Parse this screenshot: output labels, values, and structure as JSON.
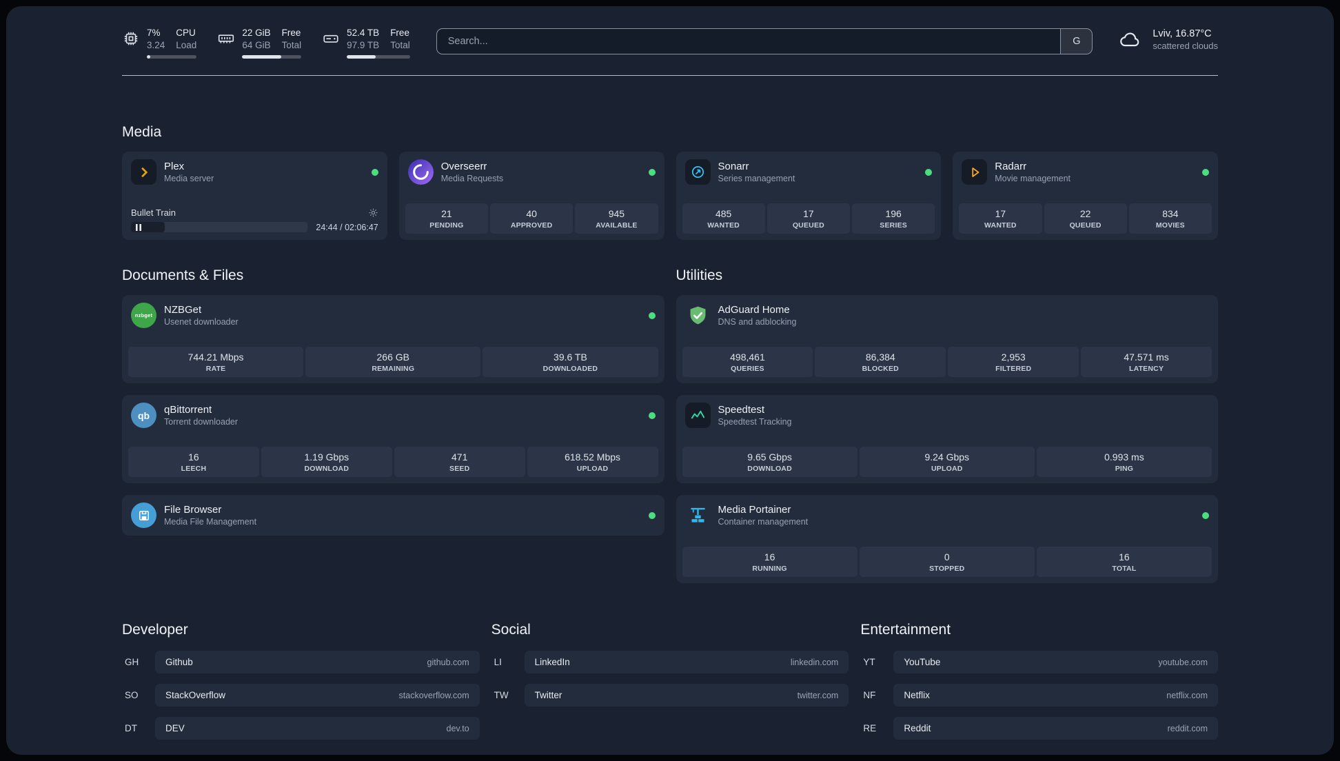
{
  "colors": {
    "status-green": "#4ade80",
    "plex-accent": "#e5a00d",
    "sonarr-accent": "#35c5f4",
    "radarr-accent": "#f9a825",
    "nzbget-accent": "#3fa549",
    "qbittorrent-accent": "#4d8fc0",
    "filebrowser-accent": "#459fd6",
    "adguard-accent": "#68bc71",
    "speedtest-accent": "#31d8a4",
    "portainer-accent": "#2fb8ee"
  },
  "topbar": {
    "resources": [
      {
        "name": "cpu",
        "value": "7%",
        "value2": "3.24",
        "label": "CPU",
        "label2": "Load",
        "progress_pct": 7
      },
      {
        "name": "memory",
        "value": "22 GiB",
        "value2": "64 GiB",
        "label": "Free",
        "label2": "Total",
        "progress_pct": 66
      },
      {
        "name": "disk",
        "value": "52.4 TB",
        "value2": "97.9 TB",
        "label": "Free",
        "label2": "Total",
        "progress_pct": 46
      }
    ],
    "search": {
      "placeholder": "Search...",
      "button_label": "G"
    },
    "weather": {
      "location": "Lviv, 16.87°C",
      "condition": "scattered clouds"
    }
  },
  "media": {
    "title": "Media",
    "cards": [
      {
        "name": "Plex",
        "desc": "Media server",
        "status": "online",
        "player": {
          "track": "Bullet Train",
          "time": "24:44 / 02:06:47",
          "progress_pct": 19
        }
      },
      {
        "name": "Overseerr",
        "desc": "Media Requests",
        "status": "online",
        "stats": [
          {
            "value": "21",
            "label": "PENDING"
          },
          {
            "value": "40",
            "label": "APPROVED"
          },
          {
            "value": "945",
            "label": "AVAILABLE"
          }
        ]
      },
      {
        "name": "Sonarr",
        "desc": "Series management",
        "status": "online",
        "stats": [
          {
            "value": "485",
            "label": "WANTED"
          },
          {
            "value": "17",
            "label": "QUEUED"
          },
          {
            "value": "196",
            "label": "SERIES"
          }
        ]
      },
      {
        "name": "Radarr",
        "desc": "Movie management",
        "status": "online",
        "stats": [
          {
            "value": "17",
            "label": "WANTED"
          },
          {
            "value": "22",
            "label": "QUEUED"
          },
          {
            "value": "834",
            "label": "MOVIES"
          }
        ]
      }
    ]
  },
  "documents": {
    "title": "Documents & Files",
    "cards": [
      {
        "name": "NZBGet",
        "desc": "Usenet downloader",
        "status": "online",
        "icon_text": "nzbget",
        "stats": [
          {
            "value": "744.21 Mbps",
            "label": "RATE"
          },
          {
            "value": "266 GB",
            "label": "REMAINING"
          },
          {
            "value": "39.6 TB",
            "label": "DOWNLOADED"
          }
        ]
      },
      {
        "name": "qBittorrent",
        "desc": "Torrent downloader",
        "status": "online",
        "icon_text": "qb",
        "stats": [
          {
            "value": "16",
            "label": "LEECH"
          },
          {
            "value": "1.19 Gbps",
            "label": "DOWNLOAD"
          },
          {
            "value": "471",
            "label": "SEED"
          },
          {
            "value": "618.52 Mbps",
            "label": "UPLOAD"
          }
        ]
      },
      {
        "name": "File Browser",
        "desc": "Media File Management",
        "status": "online",
        "stats": []
      }
    ]
  },
  "utilities": {
    "title": "Utilities",
    "cards": [
      {
        "name": "AdGuard Home",
        "desc": "DNS and adblocking",
        "stats": [
          {
            "value": "498,461",
            "label": "QUERIES"
          },
          {
            "value": "86,384",
            "label": "BLOCKED"
          },
          {
            "value": "2,953",
            "label": "FILTERED"
          },
          {
            "value": "47.571 ms",
            "label": "LATENCY"
          }
        ]
      },
      {
        "name": "Speedtest",
        "desc": "Speedtest Tracking",
        "stats": [
          {
            "value": "9.65 Gbps",
            "label": "DOWNLOAD"
          },
          {
            "value": "9.24 Gbps",
            "label": "UPLOAD"
          },
          {
            "value": "0.993 ms",
            "label": "PING"
          }
        ]
      },
      {
        "name": "Media Portainer",
        "desc": "Container management",
        "status": "online",
        "stats": [
          {
            "value": "16",
            "label": "RUNNING"
          },
          {
            "value": "0",
            "label": "STOPPED"
          },
          {
            "value": "16",
            "label": "TOTAL"
          }
        ]
      }
    ]
  },
  "bookmarks": {
    "groups": [
      {
        "title": "Developer",
        "items": [
          {
            "abbr": "GH",
            "name": "Github",
            "url": "github.com"
          },
          {
            "abbr": "SO",
            "name": "StackOverflow",
            "url": "stackoverflow.com"
          },
          {
            "abbr": "DT",
            "name": "DEV",
            "url": "dev.to"
          }
        ]
      },
      {
        "title": "Social",
        "items": [
          {
            "abbr": "LI",
            "name": "LinkedIn",
            "url": "linkedin.com"
          },
          {
            "abbr": "TW",
            "name": "Twitter",
            "url": "twitter.com"
          }
        ]
      },
      {
        "title": "Entertainment",
        "items": [
          {
            "abbr": "YT",
            "name": "YouTube",
            "url": "youtube.com"
          },
          {
            "abbr": "NF",
            "name": "Netflix",
            "url": "netflix.com"
          },
          {
            "abbr": "RE",
            "name": "Reddit",
            "url": "reddit.com"
          }
        ]
      }
    ]
  }
}
